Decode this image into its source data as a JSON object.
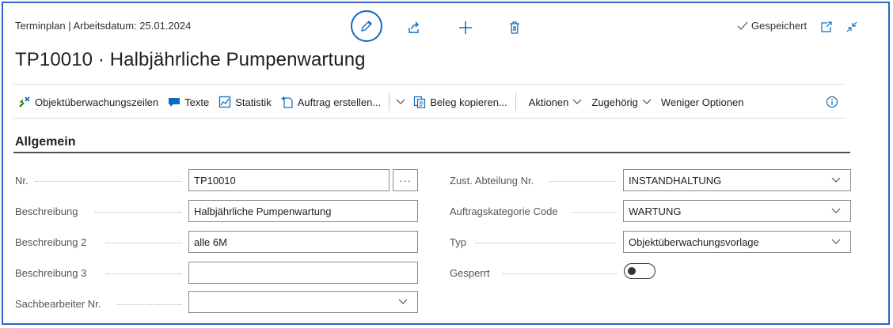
{
  "header": {
    "context": "Terminplan | Arbeitsdatum: 25.01.2024",
    "title": "TP10010 · Halbjährliche Pumpenwartung",
    "saved_label": "Gespeichert"
  },
  "actions": {
    "objektueberwachungszeilen": "Objektüberwachungszeilen",
    "texte": "Texte",
    "statistik": "Statistik",
    "auftrag_erstellen": "Auftrag erstellen...",
    "beleg_kopieren": "Beleg kopieren...",
    "aktionen": "Aktionen",
    "zugehoerig": "Zugehörig",
    "weniger_optionen": "Weniger Optionen"
  },
  "section": {
    "title": "Allgemein"
  },
  "fields": {
    "nr": {
      "label": "Nr.",
      "value": "TP10010",
      "more": "···"
    },
    "beschreibung": {
      "label": "Beschreibung",
      "value": "Halbjährliche Pumpenwartung"
    },
    "beschreibung2": {
      "label": "Beschreibung 2",
      "value": "alle 6M"
    },
    "beschreibung3": {
      "label": "Beschreibung 3",
      "value": ""
    },
    "sachbearbeiter": {
      "label": "Sachbearbeiter Nr.",
      "value": ""
    },
    "abteilung": {
      "label": "Zust. Abteilung Nr.",
      "value": "INSTANDHALTUNG"
    },
    "auftragskategorie": {
      "label": "Auftragskategorie Code",
      "value": "WARTUNG"
    },
    "typ": {
      "label": "Typ",
      "value": "Objektüberwachungsvorlage"
    },
    "gesperrt": {
      "label": "Gesperrt",
      "value": false
    }
  },
  "colors": {
    "accent": "#0f6cbd",
    "frame": "#2f65c7",
    "green": "#107c10"
  }
}
